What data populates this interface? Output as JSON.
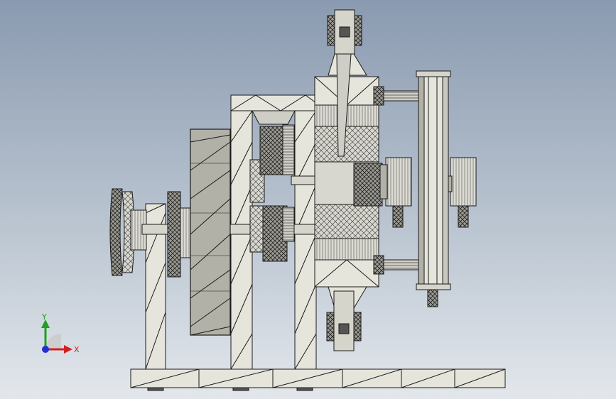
{
  "viewport": {
    "background_top": "#8a9ab0",
    "background_bottom": "#e3e7ec",
    "part_fill": "#e6e5dc",
    "part_shade": "#8e8e88",
    "edge_color": "#1a1a1a"
  },
  "triad": {
    "x_label": "X",
    "y_label": "Y",
    "x_color": "#d42020",
    "y_color": "#20a020",
    "z_color": "#2030d0"
  }
}
